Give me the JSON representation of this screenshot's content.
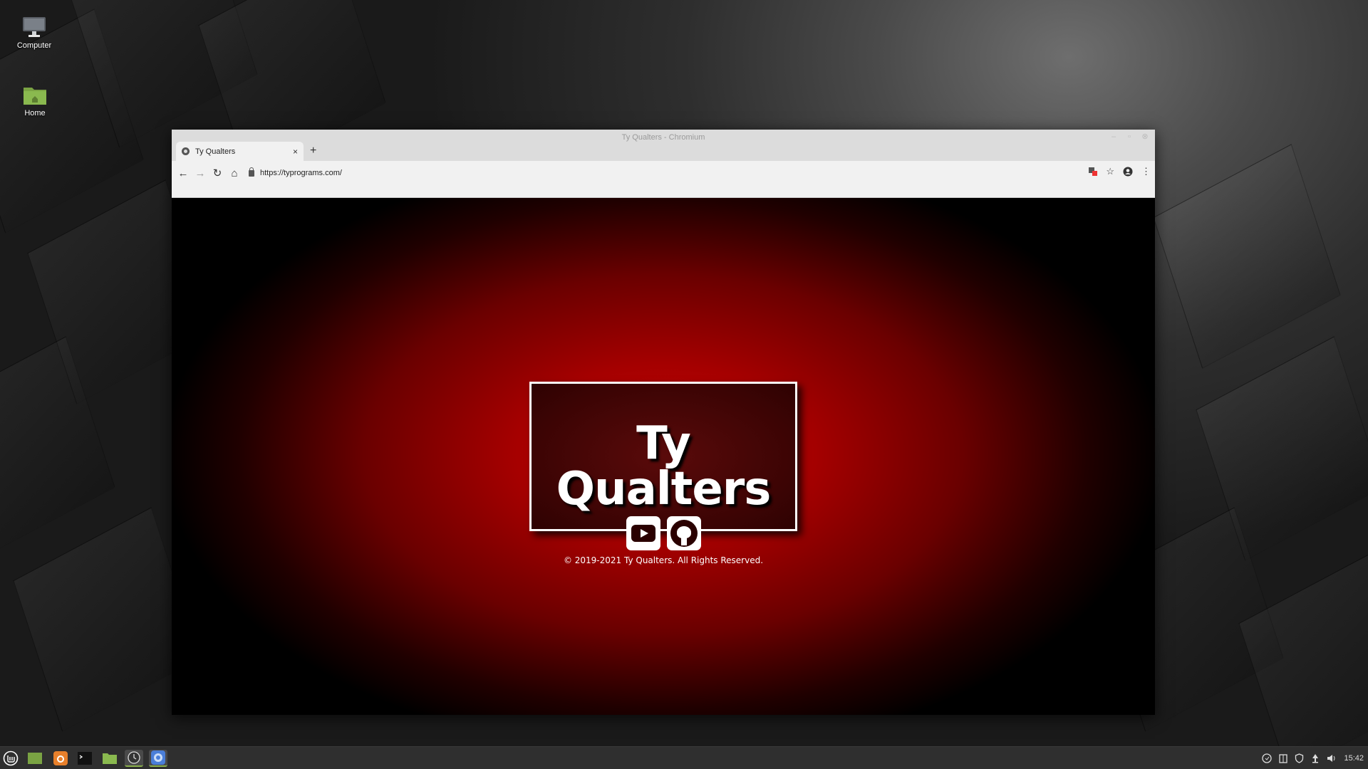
{
  "desktop": {
    "icons": [
      {
        "label": "Computer",
        "icon": "computer-icon"
      },
      {
        "label": "Home",
        "icon": "home-folder-icon"
      }
    ]
  },
  "browser": {
    "window_title": "Ty Qualters - Chromium",
    "tabs": [
      {
        "label": "Ty Qualters",
        "close": "×"
      }
    ],
    "new_tab": "+",
    "url": "https://typrograms.com/",
    "nav": {
      "back": "←",
      "forward": "→",
      "reload": "↻",
      "home": "⌂"
    },
    "toolbar_right": {
      "bookmark": "☆",
      "menu": "⋮"
    }
  },
  "page": {
    "title": "Ty Qualters",
    "social": [
      {
        "name": "youtube",
        "icon": "youtube-icon"
      },
      {
        "name": "github",
        "icon": "github-icon"
      }
    ],
    "copyright": "© 2019-2021 Ty Qualters. All Rights Reserved."
  },
  "taskbar": {
    "clock": "15:42",
    "apps": [
      "menu-icon",
      "show-desktop-icon",
      "firefox-icon",
      "terminal-icon",
      "files-icon",
      "app-icon",
      "chromium-icon"
    ]
  },
  "colors": {
    "page_red": "#c80b0b",
    "card_bg": "#3c0404",
    "taskbar": "#2f2f2f"
  }
}
